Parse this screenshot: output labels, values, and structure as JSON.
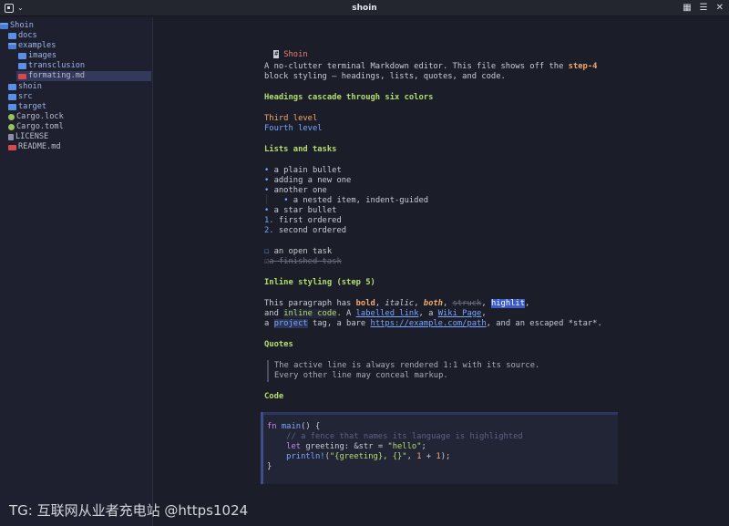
{
  "window": {
    "title": "shoin"
  },
  "titlebar": {
    "layout_icon": "layout-grid-icon",
    "menu_icon": "hamburger-menu-icon",
    "close_icon": "close-icon"
  },
  "sidebar": {
    "items": [
      {
        "label": "Shoin",
        "kind": "folder-open"
      },
      {
        "label": "docs",
        "kind": "folder"
      },
      {
        "label": "examples",
        "kind": "folder-open"
      },
      {
        "label": "images",
        "kind": "folder"
      },
      {
        "label": "transclusion",
        "kind": "folder"
      },
      {
        "label": "formating.md",
        "kind": "md",
        "selected": true
      },
      {
        "label": "shoin",
        "kind": "folder"
      },
      {
        "label": "src",
        "kind": "folder"
      },
      {
        "label": "target",
        "kind": "folder"
      },
      {
        "label": "Cargo.lock",
        "kind": "cargo"
      },
      {
        "label": "Cargo.toml",
        "kind": "cargo"
      },
      {
        "label": "LICENSE",
        "kind": "lic"
      },
      {
        "label": "README.md",
        "kind": "readme"
      }
    ]
  },
  "doc": {
    "h1": "Shoin",
    "intro1_a": "A no-clutter terminal Markdown editor. This file shows off the ",
    "intro1_b": "step-4",
    "intro2": "block styling — headings, lists, quotes, and code.",
    "h_cascade": "Headings cascade through six colors",
    "third": "Third level",
    "fourth": "Fourth level",
    "h_lists": "Lists and tasks",
    "b1": "a plain bullet",
    "b2": "adding a new one",
    "b3": "another one",
    "b4": "a nested item, indent-guided",
    "b5": "a star bullet",
    "o1_num": "1.",
    "o1": "first ordered",
    "o2_num": "2.",
    "o2": "second ordered",
    "task_open": "an open task",
    "task_done": "a finished task",
    "h_inline": "Inline styling (step 5)",
    "p1_a": "This paragraph has ",
    "p1_bold": "bold",
    "p1_b": ", ",
    "p1_ital": "italic",
    "p1_c": ", ",
    "p1_both": "both",
    "p1_d": ", ",
    "p1_struck": "struck",
    "p1_e": ", ",
    "p1_hl": "highlit",
    "p1_f": ",",
    "p2_a": "and ",
    "p2_code": "inline code",
    "p2_b": ". A ",
    "p2_link": "labelled link",
    "p2_c": ", a ",
    "p2_wiki": "Wiki Page",
    "p2_d": ",",
    "p3_a": "a ",
    "p3_tag": "project",
    "p3_b": " tag, a bare ",
    "p3_url": "https://example.com/path",
    "p3_c": ", and an escaped *star*.",
    "h_quotes": "Quotes",
    "q1": "The active line is always rendered 1:1 with its source.",
    "q2": "Every other line may conceal markup.",
    "h_code": "Code",
    "code": {
      "l1_kw": "fn",
      "l1_fn": " main",
      "l1_rest": "() {",
      "l2": "    // a fence that names its language is highlighted",
      "l3_kw": "    let",
      "l3_a": " greeting: &str = ",
      "l3_str": "\"hello\"",
      "l3_b": ";",
      "l4_fn": "    println!",
      "l4_a": "(",
      "l4_str": "\"{greeting}, {}\"",
      "l4_b": ", ",
      "l4_n1": "1",
      "l4_c": " + ",
      "l4_n2": "1",
      "l4_d": ");",
      "l5": "}"
    }
  },
  "watermark": "TG: 互联网从业者充电站 @https1024"
}
